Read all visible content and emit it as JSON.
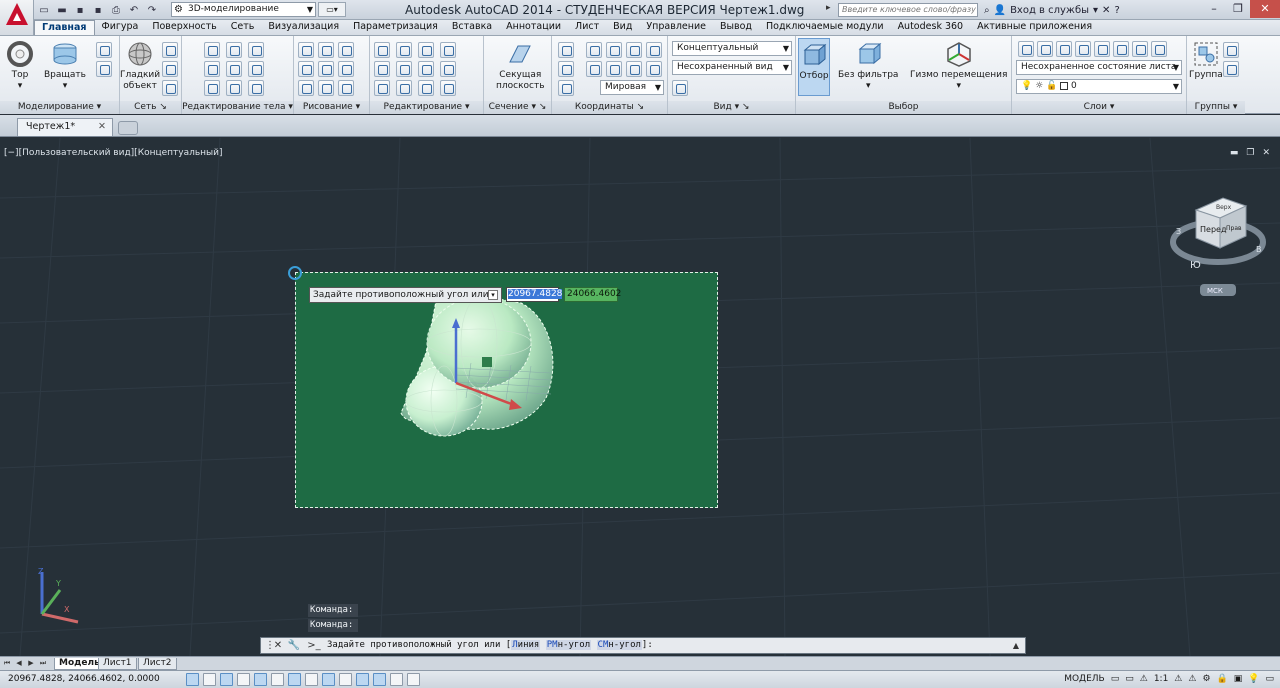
{
  "window": {
    "title": "Autodesk AutoCAD 2014 - СТУДЕНЧЕСКАЯ ВЕРСИЯ    Чертеж1.dwg",
    "workspace": "3D-моделирование",
    "search_placeholder": "Введите ключевое слово/фразу",
    "signin": "Вход в службы"
  },
  "ribbon_tabs": [
    "Главная",
    "Фигура",
    "Поверхность",
    "Сеть",
    "Визуализация",
    "Параметризация",
    "Вставка",
    "Аннотации",
    "Лист",
    "Вид",
    "Управление",
    "Вывод",
    "Подключаемые модули",
    "Autodesk 360",
    "Активные приложения"
  ],
  "active_tab": "Главная",
  "ribbon": {
    "modeling": {
      "label": "Моделирование",
      "tor": "Тор",
      "rotate": "Вращать"
    },
    "mesh": {
      "label": "Сеть",
      "smooth_l1": "Гладкий",
      "smooth_l2": "объект"
    },
    "solid_edit": {
      "label": "Редактирование тела"
    },
    "draw": {
      "label": "Рисование"
    },
    "modify": {
      "label": "Редактирование"
    },
    "section": {
      "label": "Сечение",
      "plane_l1": "Секущая",
      "plane_l2": "плоскость"
    },
    "coords": {
      "label": "Координаты",
      "world": "Мировая"
    },
    "view": {
      "label": "Вид",
      "visual_style": "Концептуальный",
      "saved_view": "Несохраненный вид"
    },
    "selection": {
      "label": "Выбор",
      "cull": "Отбор",
      "no_filter": "Без фильтра",
      "gizmo": "Гизмо перемещения"
    },
    "layers": {
      "label": "Слои",
      "layer_state": "Несохраненное состояние листа",
      "current_layer": "0"
    },
    "groups": {
      "label": "Группы",
      "group": "Группа"
    }
  },
  "document": {
    "tab": "Чертеж1*"
  },
  "viewport": {
    "label": "[−][Пользовательский вид][Концептуальный]",
    "viewcube": {
      "top": "Верх",
      "front": "Перед",
      "right": "Прав",
      "south": "Ю",
      "west": "З",
      "east": "В",
      "ucs": "МСК"
    },
    "prompt": "Задайте противоположный угол или",
    "x_value": "20967.4828",
    "y_value": "24066.4602"
  },
  "command_history": [
    "Команда:",
    "Команда:"
  ],
  "command_line": {
    "text": "Задайте противоположный угол или [",
    "options": [
      {
        "key": "Л",
        "rest": "иния"
      },
      {
        "key": "РМ",
        "rest": "н-угол"
      },
      {
        "key": "СМ",
        "rest": "н-угол"
      }
    ],
    "end": "]:"
  },
  "layouts": [
    "Модель",
    "Лист1",
    "Лист2"
  ],
  "status": {
    "coords": "20967.4828, 24066.4602, 0.0000",
    "mode": "МОДЕЛЬ",
    "scale": "1:1"
  }
}
